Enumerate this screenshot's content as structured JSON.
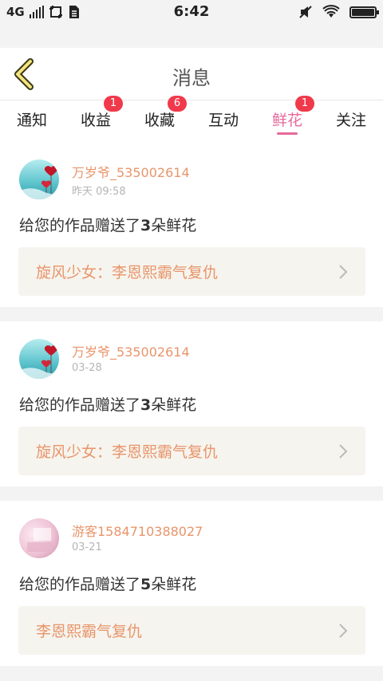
{
  "status_bar": {
    "network": "4G",
    "time": "6:42"
  },
  "header": {
    "title": "消息"
  },
  "tabs": [
    {
      "label": "通知",
      "badge": ""
    },
    {
      "label": "收益",
      "badge": "1"
    },
    {
      "label": "收藏",
      "badge": "6"
    },
    {
      "label": "互动",
      "badge": ""
    },
    {
      "label": "鲜花",
      "badge": "1",
      "active": true
    },
    {
      "label": "关注",
      "badge": ""
    }
  ],
  "messages": [
    {
      "username": "万岁爷_535002614",
      "time": "昨天 09:58",
      "msg_prefix": "给您的作品赠送了",
      "count": "3",
      "msg_suffix": "朵鲜花",
      "work": "旋风少女：李恩熙霸气复仇"
    },
    {
      "username": "万岁爷_535002614",
      "time": "03-28",
      "msg_prefix": "给您的作品赠送了",
      "count": "3",
      "msg_suffix": "朵鲜花",
      "work": "旋风少女：李恩熙霸气复仇"
    },
    {
      "username": "游客1584710388027",
      "time": "03-21",
      "msg_prefix": "给您的作品赠送了",
      "count": "5",
      "msg_suffix": "朵鲜花",
      "work": "李恩熙霸气复仇"
    }
  ],
  "colors": {
    "accent": "#e76a9b",
    "username": "#e8956b",
    "badge": "#f0394b"
  }
}
